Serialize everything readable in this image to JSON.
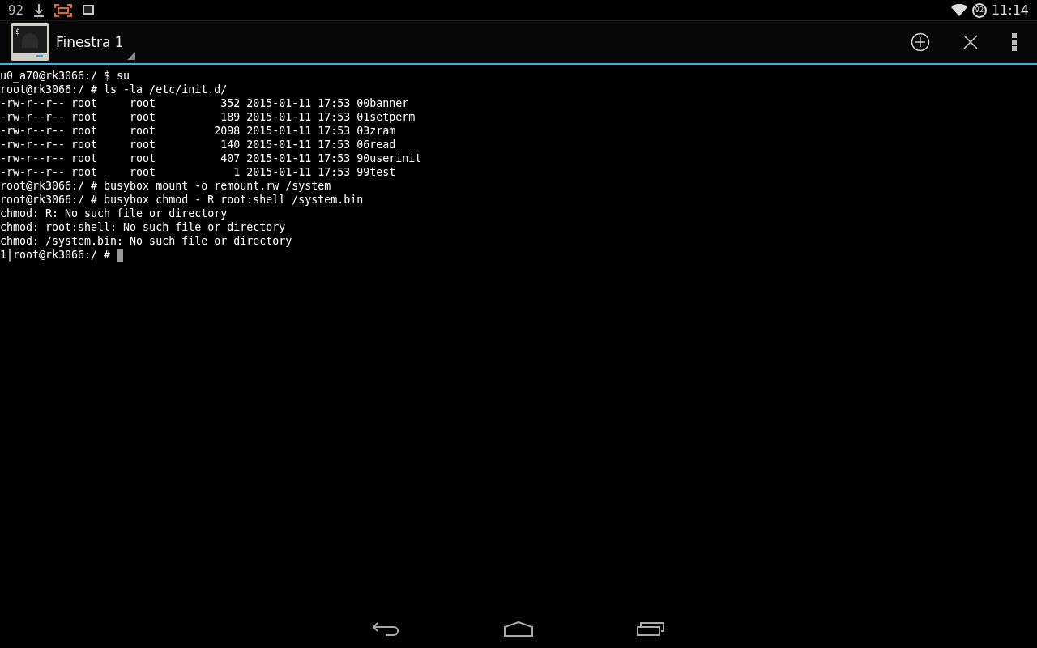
{
  "status_bar": {
    "notification_count": "92",
    "battery_level_text": "92",
    "time": "11:14"
  },
  "action_bar": {
    "app_icon_glyph": "$",
    "title": "Finestra 1"
  },
  "terminal": {
    "lines": [
      "u0_a70@rk3066:/ $ su",
      "root@rk3066:/ # ls -la /etc/init.d/",
      "-rw-r--r-- root     root          352 2015-01-11 17:53 00banner",
      "-rw-r--r-- root     root          189 2015-01-11 17:53 01setperm",
      "-rw-r--r-- root     root         2098 2015-01-11 17:53 03zram",
      "-rw-r--r-- root     root          140 2015-01-11 17:53 06read",
      "-rw-r--r-- root     root          407 2015-01-11 17:53 90userinit",
      "-rw-r--r-- root     root            1 2015-01-11 17:53 99test",
      "root@rk3066:/ # busybox mount -o remount,rw /system",
      "root@rk3066:/ # busybox chmod - R root:shell /system.bin",
      "chmod: R: No such file or directory",
      "chmod: root:shell: No such file or directory",
      "chmod: /system.bin: No such file or directory"
    ],
    "prompt": "1|root@rk3066:/ # "
  }
}
